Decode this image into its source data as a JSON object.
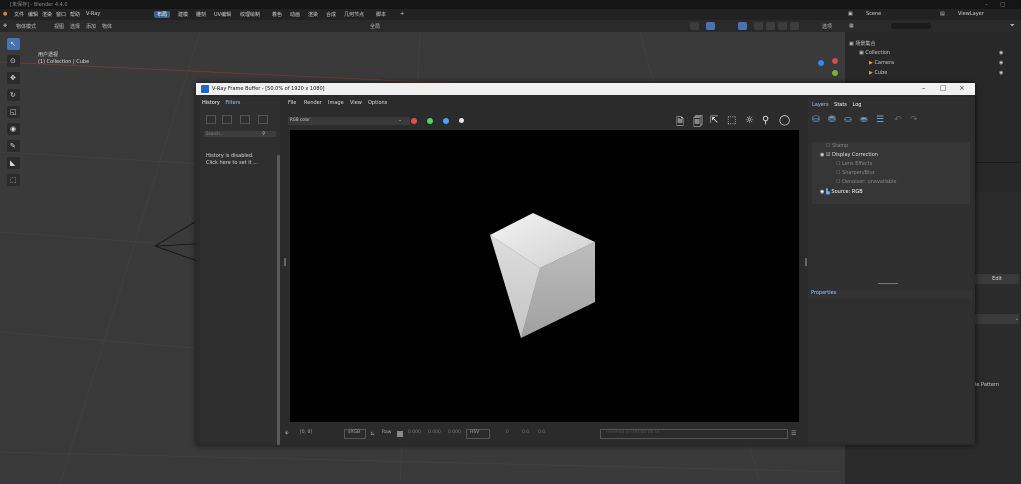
{
  "blender": {
    "title": "[未保存] - Blender 4.4.0",
    "menus": [
      "文件",
      "编辑",
      "渲染",
      "窗口",
      "帮助",
      "V-Ray"
    ],
    "workspaces": [
      "布局",
      "建模",
      "雕刻",
      "UV编辑",
      "纹理绘制",
      "着色",
      "动画",
      "渲染",
      "合成",
      "几何节点",
      "脚本"
    ],
    "header_items": [
      "物体模式",
      "视图",
      "选择",
      "添加",
      "物体"
    ],
    "header_center": [
      "全局",
      "选项"
    ],
    "scene_label": "Scene",
    "viewlayer_label": "ViewLayer",
    "viewport_info": [
      "用户透视",
      "(1) Collection | Cube"
    ],
    "outliner": {
      "header": "场景集合",
      "items": [
        {
          "label": "Collection"
        },
        {
          "label": "Camera"
        },
        {
          "label": "Cube"
        }
      ],
      "view_label": "选项"
    },
    "side_label": "le Pattern",
    "side_button": "Edit"
  },
  "vfb": {
    "title": "V-Ray Frame Buffer - [50.0% of 1920 x 1080]",
    "history_tabs": [
      "History",
      "Filters"
    ],
    "history_search_placeholder": "Search...",
    "history_message": [
      "History is disabled.",
      "Click here to set it ..."
    ],
    "menu": [
      "File",
      "Render",
      "Image",
      "View",
      "Options"
    ],
    "channel": "RGB color",
    "dots": [
      "#e84d4d",
      "#4cd964",
      "#4da3ff",
      "#e6e6e6"
    ],
    "bottom": {
      "coords": "[0, 0]",
      "srgb": "sRGB",
      "raw_label": "Raw",
      "vals": [
        "0.000",
        "0.000",
        "0.000"
      ],
      "hsv": "HSV",
      "hsv_vals": [
        "0",
        "0.0",
        "0.0"
      ],
      "status": "Finished in [00:00:00.0]"
    },
    "layers_tabs": [
      "Layers",
      "Stats",
      "Log"
    ],
    "layers": [
      {
        "label": "Stamp",
        "state": "off"
      },
      {
        "label": "Display Correction",
        "state": "on"
      },
      {
        "label": "Lens Effects",
        "state": "off"
      },
      {
        "label": "Sharpen/Blur",
        "state": "off"
      },
      {
        "label": "Denoiser: unavailable",
        "state": "off"
      },
      {
        "label": "Source: RGB",
        "state": "sel"
      }
    ],
    "properties_label": "Properties"
  }
}
